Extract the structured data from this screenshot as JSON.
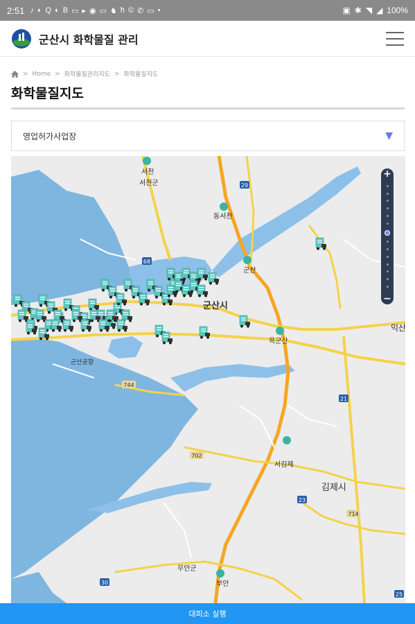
{
  "statusbar": {
    "time": "2:51",
    "left_icons": [
      "♪",
      "◐",
      "Q",
      "◐",
      "B",
      "▭",
      "▸",
      "◉",
      "▭",
      "♞",
      "ħ",
      "©",
      "✆",
      "▭",
      "•"
    ],
    "right_icons": [
      "▣",
      "✱",
      "◥",
      "◢"
    ],
    "battery": "100%"
  },
  "app": {
    "title": "군산시 화학물질 관리",
    "logo_icon": "city-emblem-icon",
    "menu_icon": "hamburger-menu-icon"
  },
  "breadcrumb": {
    "items": [
      "Home",
      "화학물질관리지도",
      "화학물질지도"
    ],
    "separator": ">"
  },
  "page": {
    "title": "화학물질지도"
  },
  "filter": {
    "selected": "영업허가사업장",
    "caret_icon": "triangle-down-icon"
  },
  "map": {
    "zoom_in": "+",
    "zoom_out": "−",
    "zoom_level_fraction": 0.45,
    "place_labels": [
      "서천",
      "서천군",
      "동서천",
      "군산",
      "군산시",
      "옥군산",
      "군산공항",
      "서김제",
      "김제시",
      "익산",
      "무안군",
      "부안"
    ],
    "road_labels": [
      "29",
      "68",
      "744",
      "702",
      "23",
      "714",
      "21",
      "25",
      "30"
    ],
    "colors": {
      "sea": "#7fb6e0",
      "land": "#ececec",
      "highway": "#f5a623",
      "road": "#f4d24a",
      "river": "#8cc0e8",
      "marker": "#5cc7c0"
    }
  },
  "bottom_button": {
    "label": "대피소 실행"
  }
}
